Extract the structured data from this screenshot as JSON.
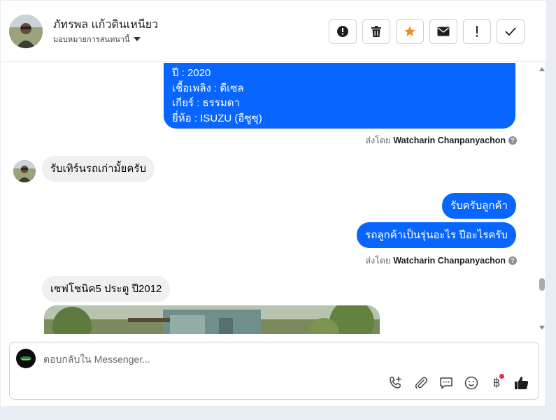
{
  "header": {
    "contact_name": "ภัทรพล แก้วดินเหนียว",
    "assign_label": "มอบหมายการสนทนานี้",
    "actions": [
      {
        "icon": "alert-circle-icon",
        "label": "!"
      },
      {
        "icon": "trash-icon",
        "label": ""
      },
      {
        "icon": "star-icon",
        "label": ""
      },
      {
        "icon": "envelope-icon",
        "label": ""
      },
      {
        "icon": "exclamation-icon",
        "label": "!"
      },
      {
        "icon": "check-icon",
        "label": ""
      }
    ]
  },
  "messages": {
    "first_card": {
      "lines": [
        "ปี : 2020",
        "เชื้อเพลิง : ดีเซล",
        "เกียร์ : ธรรมดา",
        "ยี่ห้อ : ISUZU (อีซูซุ)"
      ]
    },
    "sent_by_1": {
      "prefix": "ส่งโดย",
      "name": "Watcharin Chanpanyachon",
      "help": "?"
    },
    "incoming_1": "รับเทิร์นรถเก่ามั้ยครับ",
    "outgoing_1": "รับครับลูกค้า",
    "outgoing_2": "รถลูกค้าเป็นรุ่นอะไร ปีอะไรครับ",
    "sent_by_2": {
      "prefix": "ส่งโดย",
      "name": "Watcharin Chanpanyachon",
      "help": "?"
    },
    "incoming_2": "เซฟโชนิค5 ประตู ปี2012"
  },
  "composer": {
    "placeholder": "ตอบกลับใน Messenger...",
    "value": "",
    "baht_symbol": "฿"
  },
  "colors": {
    "accent": "#0866ff",
    "star": "#f28a24",
    "notification": "#f02849"
  }
}
